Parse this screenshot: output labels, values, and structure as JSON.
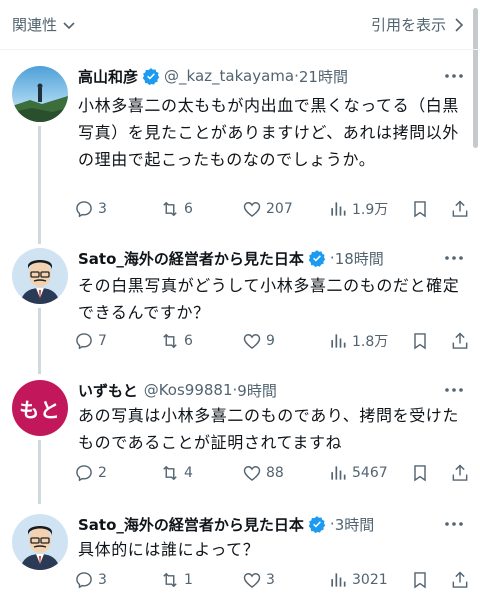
{
  "topbar": {
    "sort_label": "関連性",
    "quotes_label": "引用を表示"
  },
  "colors": {
    "verified": "#1d9bf0",
    "text_secondary": "#536471",
    "avatar_mo_bg": "#c2185b"
  },
  "tweets": [
    {
      "name": "高山和彦",
      "handle": "@_kaz_takayama",
      "dot": "·",
      "time": "21時間",
      "text": "小林多喜二の太ももが内出血で黒くなってる（白黒写真）を見たことがありますけど、あれは拷問以外の理由で起こったものなのでしょうか。",
      "replies": "3",
      "reposts": "6",
      "likes": "207",
      "views": "1.9万"
    },
    {
      "name": "Sato_海外の経営者から見た日本",
      "handle": "",
      "dot": "·",
      "time": "18時間",
      "text": "その白黒写真がどうして小林多喜二のものだと確定できるんですか？",
      "replies": "7",
      "reposts": "6",
      "likes": "9",
      "views": "1.8万"
    },
    {
      "name": "いずもと",
      "handle": "@Kos99881",
      "dot": "·",
      "time": "9時間",
      "avatar_text": "もと",
      "text": "あの写真は小林多喜二のものであり、拷問を受けたものであることが証明されてますね",
      "replies": "2",
      "reposts": "4",
      "likes": "88",
      "views": "5467"
    },
    {
      "name": "Sato_海外の経営者から見た日本",
      "handle": "",
      "dot": "·",
      "time": "3時間",
      "text": "具体的には誰によって？",
      "replies": "3",
      "reposts": "1",
      "likes": "3",
      "views": "3021"
    }
  ]
}
